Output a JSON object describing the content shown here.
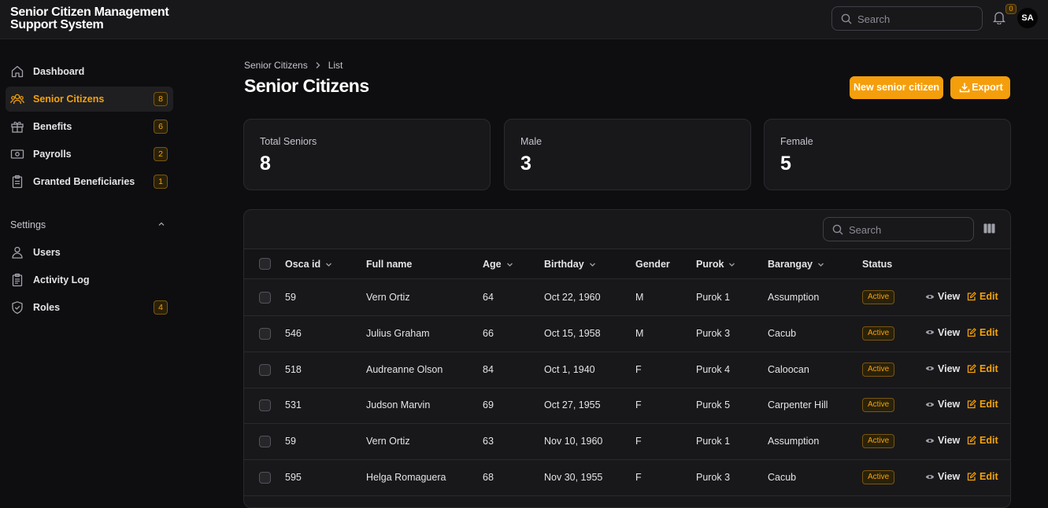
{
  "app": {
    "title": "Senior Citizen Management Support System",
    "title_line1": "Senior Citizen Management",
    "title_line2": "Support System"
  },
  "topbar": {
    "search_placeholder": "Search",
    "notifications_count": "0",
    "avatar_initials": "SA"
  },
  "sidebar": {
    "items": [
      {
        "label": "Dashboard",
        "icon": "home-icon",
        "badge": ""
      },
      {
        "label": "Senior Citizens",
        "icon": "users-icon",
        "badge": "8",
        "active": true
      },
      {
        "label": "Benefits",
        "icon": "gift-icon",
        "badge": "6"
      },
      {
        "label": "Payrolls",
        "icon": "cash-icon",
        "badge": "2"
      },
      {
        "label": "Granted Beneficiaries",
        "icon": "clipboard-icon",
        "badge": "1"
      }
    ],
    "settings_group": {
      "label": "Settings",
      "items": [
        {
          "label": "Users",
          "icon": "user-icon",
          "badge": ""
        },
        {
          "label": "Activity Log",
          "icon": "clipboard-list-icon",
          "badge": ""
        },
        {
          "label": "Roles",
          "icon": "shield-icon",
          "badge": "4"
        }
      ]
    }
  },
  "breadcrumb": {
    "parent": "Senior Citizens",
    "current": "List"
  },
  "page": {
    "title": "Senior Citizens",
    "new_button": "New senior citizen",
    "export_button": "Export"
  },
  "stats": [
    {
      "label": "Total Seniors",
      "value": "8"
    },
    {
      "label": "Male",
      "value": "3"
    },
    {
      "label": "Female",
      "value": "5"
    }
  ],
  "table": {
    "search_placeholder": "Search",
    "columns": [
      "Osca id",
      "Full name",
      "Age",
      "Birthday",
      "Gender",
      "Purok",
      "Barangay",
      "Status"
    ],
    "view_label": "View",
    "edit_label": "Edit",
    "rows": [
      {
        "osca_id": "59",
        "full_name": "Vern Ortiz",
        "age": "64",
        "birthday": "Oct 22, 1960",
        "gender": "M",
        "purok": "Purok 1",
        "barangay": "Assumption",
        "status": "Active"
      },
      {
        "osca_id": "546",
        "full_name": "Julius Graham",
        "age": "66",
        "birthday": "Oct 15, 1958",
        "gender": "M",
        "purok": "Purok 3",
        "barangay": "Cacub",
        "status": "Active"
      },
      {
        "osca_id": "518",
        "full_name": "Audreanne Olson",
        "age": "84",
        "birthday": "Oct 1, 1940",
        "gender": "F",
        "purok": "Purok 4",
        "barangay": "Caloocan",
        "status": "Active"
      },
      {
        "osca_id": "531",
        "full_name": "Judson Marvin",
        "age": "69",
        "birthday": "Oct 27, 1955",
        "gender": "F",
        "purok": "Purok 5",
        "barangay": "Carpenter Hill",
        "status": "Active"
      },
      {
        "osca_id": "59",
        "full_name": "Vern Ortiz",
        "age": "63",
        "birthday": "Nov 10, 1960",
        "gender": "F",
        "purok": "Purok 1",
        "barangay": "Assumption",
        "status": "Active"
      },
      {
        "osca_id": "595",
        "full_name": "Helga Romaguera",
        "age": "68",
        "birthday": "Nov 30, 1955",
        "gender": "F",
        "purok": "Purok 3",
        "barangay": "Cacub",
        "status": "Active"
      }
    ]
  },
  "colors": {
    "accent": "#f59e0b",
    "background": "#0e0e10",
    "surface": "#18181b"
  }
}
